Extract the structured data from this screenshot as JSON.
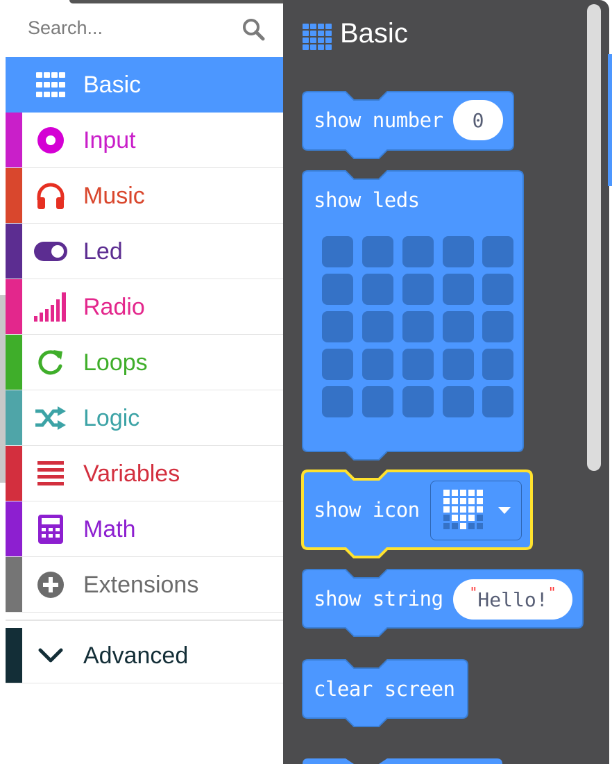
{
  "search": {
    "placeholder": "Search..."
  },
  "categories": [
    {
      "id": "basic",
      "label": "Basic",
      "color": "#4c97ff",
      "icon": "grid-icon"
    },
    {
      "id": "input",
      "label": "Input",
      "color": "#d400d4",
      "icon": "target-icon"
    },
    {
      "id": "music",
      "label": "Music",
      "color": "#e63022",
      "icon": "headphones-icon"
    },
    {
      "id": "led",
      "label": "Led",
      "color": "#5c2d91",
      "icon": "toggle-icon"
    },
    {
      "id": "radio",
      "label": "Radio",
      "color": "#e3008c",
      "icon": "signal-bars-icon"
    },
    {
      "id": "loops",
      "label": "Loops",
      "color": "#00aa00",
      "icon": "loop-arrow-icon"
    },
    {
      "id": "logic",
      "label": "Logic",
      "color": "#00a4a6",
      "icon": "shuffle-icon"
    },
    {
      "id": "variables",
      "label": "Variables",
      "color": "#dc143c",
      "icon": "list-lines-icon"
    },
    {
      "id": "math",
      "label": "Math",
      "color": "#9400d3",
      "icon": "calculator-icon"
    },
    {
      "id": "extensions",
      "label": "Extensions",
      "color": "#757575",
      "icon": "plus-circle-icon"
    },
    {
      "id": "advanced",
      "label": "Advanced",
      "color": "#132e37",
      "icon": "chevron-down-icon"
    }
  ],
  "flyout": {
    "title": "Basic",
    "title_icon": "grid-icon",
    "background": "#4c4c4e",
    "block_color": "#4c97ff",
    "blocks": {
      "show_number": {
        "label": "show number",
        "value": "0"
      },
      "show_leds": {
        "label": "show leds"
      },
      "show_icon": {
        "label": "show icon",
        "selected_icon": "heart-icon",
        "highlight": "#ffe22e"
      },
      "show_string": {
        "label": "show string",
        "value": "Hello!"
      },
      "clear_screen": {
        "label": "clear screen"
      }
    }
  }
}
